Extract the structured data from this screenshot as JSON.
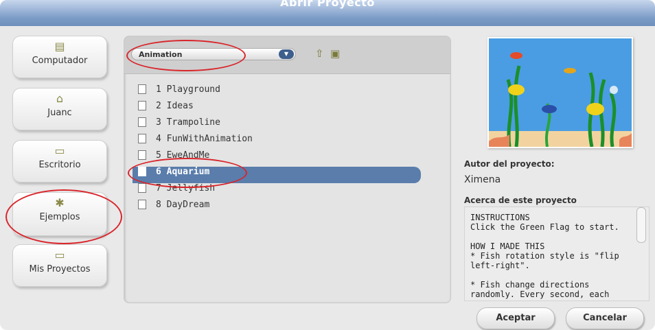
{
  "dialog": {
    "title": "Abrir Proyecto"
  },
  "locations": [
    {
      "label": "Computador",
      "icon": "computer-icon"
    },
    {
      "label": "Juanc",
      "icon": "home-icon"
    },
    {
      "label": "Escritorio",
      "icon": "folder-icon"
    },
    {
      "label": "Ejemplos",
      "icon": "examples-folder-icon"
    },
    {
      "label": "Mis Proyectos",
      "icon": "folder-icon"
    }
  ],
  "browser": {
    "current_folder": "Animation",
    "files": [
      "1 Playground",
      "2 Ideas",
      "3 Trampoline",
      "4 FunWithAnimation",
      "5 EweAndMe",
      "6 Aquarium",
      "7 Jellyfish",
      "8 DayDream"
    ],
    "selected_index": 5
  },
  "project": {
    "author_label": "Autor del proyecto:",
    "author": "Ximena",
    "about_label": "Acerca de este proyecto",
    "notes": "INSTRUCTIONS\nClick the Green Flag to start.\n\nHOW I MADE THIS\n* Fish rotation style is \"flip left-right\".\n\n* Fish change directions randomly. Every second, each"
  },
  "buttons": {
    "ok": "Aceptar",
    "cancel": "Cancelar"
  },
  "colors": {
    "title_bar": "#7b9bc7",
    "selection": "#5a7dab",
    "highlight_ring": "#d9252b"
  }
}
